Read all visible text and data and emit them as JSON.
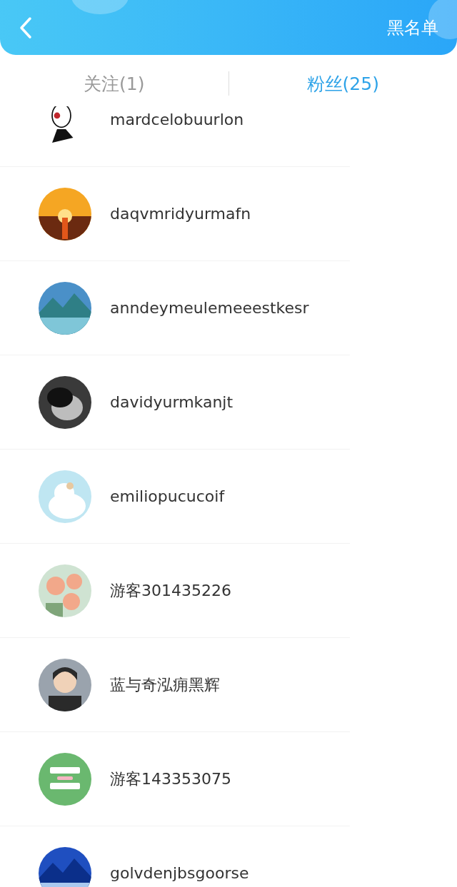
{
  "header": {
    "action": "黑名单"
  },
  "tabs": [
    {
      "label": "关注(1)",
      "selected": false
    },
    {
      "label": "粉丝(25)",
      "selected": true
    }
  ],
  "users": [
    {
      "name": "mardcelobuurlon"
    },
    {
      "name": "daqvmridyurmafn"
    },
    {
      "name": "anndeymeulemeeestkesr"
    },
    {
      "name": "davidyurmkanjt"
    },
    {
      "name": "emiliopucucoif"
    },
    {
      "name": "游客301435226"
    },
    {
      "name": "蓝与奇泓痈黑辉"
    },
    {
      "name": "游客143353075"
    },
    {
      "name": "golvdenjbsgoorse"
    }
  ]
}
